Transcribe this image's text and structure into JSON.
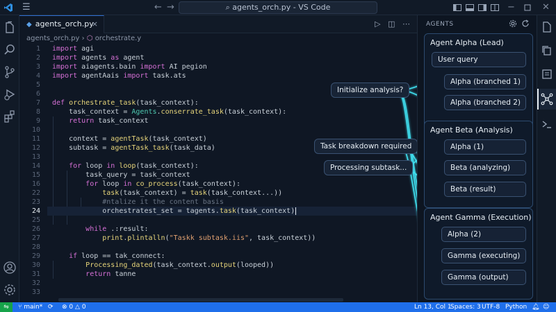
{
  "titlebar": {
    "search": "agents_orch.py - VS Code"
  },
  "tab": {
    "name": "agents_orch.py"
  },
  "breadcrumb": {
    "file": "agents_orch.py",
    "symbol": "orchestrate.y"
  },
  "code": [
    {
      "n": "1",
      "h": "<span class='k'>import</span> agi"
    },
    {
      "n": "2",
      "h": "<span class='k'>import</span> agents <span class='k'>as</span> agent"
    },
    {
      "n": "3",
      "h": "<span class='k'>import</span> aiagents.bain <span class='k'>import</span> AI pegion"
    },
    {
      "n": "4",
      "h": "<span class='k'>import</span> agentAais <span class='k'>import</span> task.ats"
    },
    {
      "n": "5",
      "h": ""
    },
    {
      "n": "6",
      "h": ""
    },
    {
      "n": "7",
      "h": "<span class='k'>def</span> <span class='f'>orchestrate_task</span>(task_context):"
    },
    {
      "n": "8",
      "h": "    task_context = <span class='t'>Agents</span>.<span class='f'>conserrate_task</span>(task_context):"
    },
    {
      "n": "9",
      "h": "    <span class='k'>return</span> task_context"
    },
    {
      "n": "10",
      "h": ""
    },
    {
      "n": "11",
      "h": "    context = <span class='f'>agentTask</span>(task_context)"
    },
    {
      "n": "12",
      "h": "    subtask = <span class='f'>agentTask_task</span>(task_data)"
    },
    {
      "n": "13",
      "h": ""
    },
    {
      "n": "14",
      "h": "    <span class='k'>for</span> loop <span class='k'>in</span> <span class='f'>loop</span>(task_context):"
    },
    {
      "n": "15",
      "h": "        task_query = task_context"
    },
    {
      "n": "16",
      "h": "        <span class='k'>for</span> loop <span class='k'>in</span> <span class='f'>co_process</span>(task_context):"
    },
    {
      "n": "22",
      "h": "            <span class='f'>task</span>(task_context) = <span class='f'>task</span>(task_context...))"
    },
    {
      "n": "23",
      "h": "            <span class='c'>#ntalize it the content basis</span>"
    },
    {
      "n": "24",
      "h": "            orchestratest_set = tagents.<span class='f'>task</span>(task_context)"
    },
    {
      "n": "25",
      "h": ""
    },
    {
      "n": "26",
      "h": "        <span class='k'>while</span> .:result:"
    },
    {
      "n": "27",
      "h": "            <span class='f'>print</span>.<span class='f'>plintalln</span>(<span class='s'>\"Taskk subtask.iis\"</span>, task_context))"
    },
    {
      "n": "28",
      "h": ""
    },
    {
      "n": "29",
      "h": "    <span class='k'>if</span> loop == tak_connect:"
    },
    {
      "n": "30",
      "h": "        <span class='f'>Processing_dated</span>(task_context.<span class='f'>output</span>(looped))"
    },
    {
      "n": "31",
      "h": "        <span class='k'>return</span> tanne"
    },
    {
      "n": "32",
      "h": ""
    },
    {
      "n": "33",
      "h": ""
    }
  ],
  "flow": {
    "initialize": "Initialize analysis?",
    "breakdown": "Task breakdown required",
    "processing": "Processing subtask..."
  },
  "panel": {
    "title": "AGENTS",
    "groups": [
      {
        "title": "Agent Alpha (Lead)",
        "items": [
          "User query",
          "Alpha (branched 1)",
          "Alpha (branched 2)"
        ]
      },
      {
        "title": "Agent Beta (Analysis)",
        "items": [
          "Alpha (1)",
          "Beta (analyzing)",
          "Beta (result)"
        ]
      },
      {
        "title": "Agent Gamma (Execution)",
        "items": [
          "Alpha (2)",
          "Gamma (executing)",
          "Gamma (output)"
        ]
      }
    ]
  },
  "status": {
    "branch": "main*",
    "problems": "0",
    "warnings": "0",
    "position": "Ln 13, Col 1",
    "spaces": "Spaces: 3",
    "encoding": "UTF-8",
    "language": "Python"
  },
  "colors": {
    "accent": "#1f6feb",
    "flow": "#3fe0f0",
    "remote": "#16a34a"
  }
}
